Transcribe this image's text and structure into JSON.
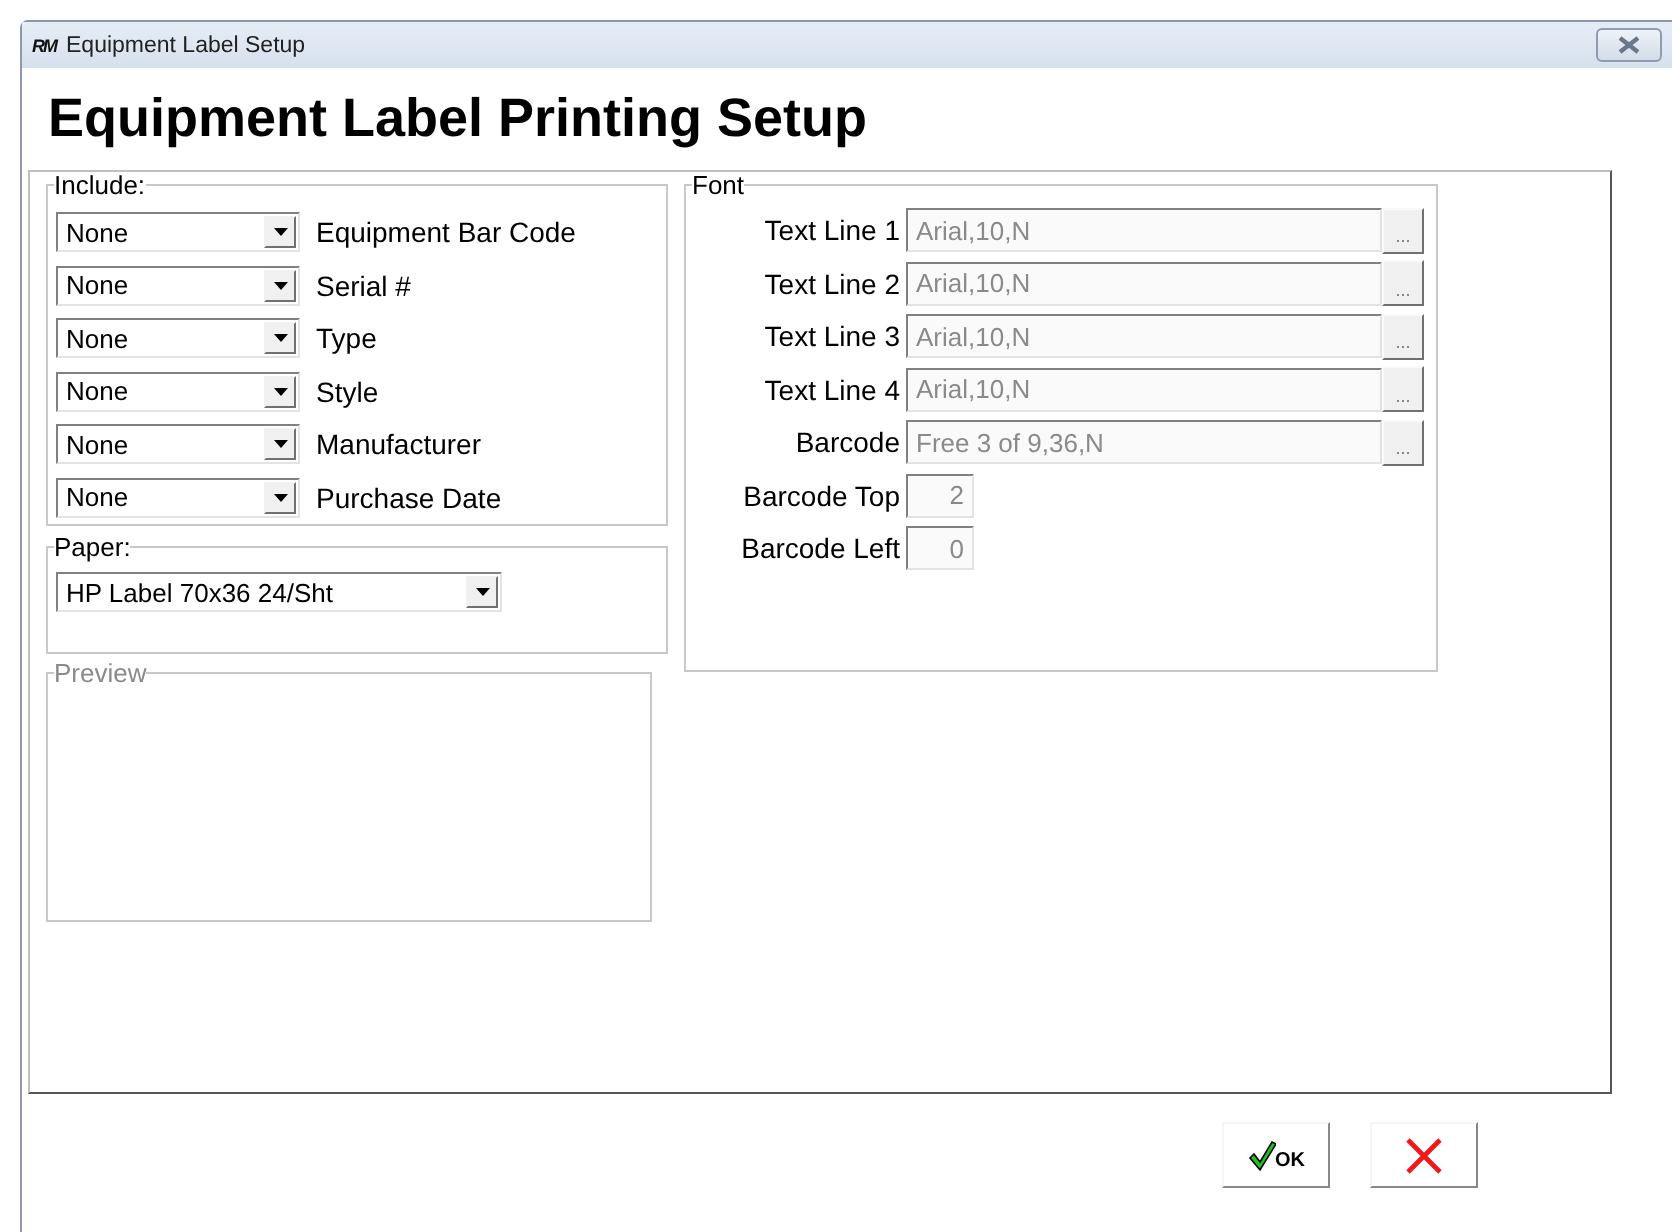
{
  "window": {
    "logo": "RM",
    "title": "Equipment Label Setup"
  },
  "heading": "Equipment Label Printing Setup",
  "include": {
    "legend": "Include:",
    "fields": [
      {
        "value": "None",
        "label": "Equipment Bar Code"
      },
      {
        "value": "None",
        "label": "Serial #"
      },
      {
        "value": "None",
        "label": "Type"
      },
      {
        "value": "None",
        "label": "Style"
      },
      {
        "value": "None",
        "label": "Manufacturer"
      },
      {
        "value": "None",
        "label": "Purchase Date"
      }
    ]
  },
  "paper": {
    "legend": "Paper:",
    "value": "HP Label 70x36 24/Sht"
  },
  "preview": {
    "legend": "Preview",
    "disabled": true
  },
  "font": {
    "legend": "Font",
    "fields": [
      {
        "kind": "font",
        "label": "Text Line 1",
        "value": "Arial,10,N",
        "button": "...",
        "disabled": true
      },
      {
        "kind": "font",
        "label": "Text Line 2",
        "value": "Arial,10,N",
        "button": "...",
        "disabled": true
      },
      {
        "kind": "font",
        "label": "Text Line 3",
        "value": "Arial,10,N",
        "button": "...",
        "disabled": true
      },
      {
        "kind": "font",
        "label": "Text Line 4",
        "value": "Arial,10,N",
        "button": "...",
        "disabled": true
      },
      {
        "kind": "font",
        "label": "Barcode",
        "value": "Free 3 of 9,36,N",
        "button": "...",
        "disabled": true
      },
      {
        "kind": "number",
        "label": "Barcode Top",
        "value": "2",
        "disabled": true
      },
      {
        "kind": "number",
        "label": "Barcode Left",
        "value": "0",
        "disabled": true
      }
    ]
  },
  "buttons": [
    {
      "kind": "ok",
      "label": "OK"
    },
    {
      "kind": "cancel"
    }
  ]
}
